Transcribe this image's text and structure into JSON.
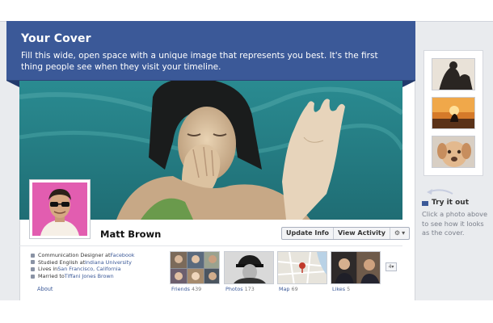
{
  "cover_tip": {
    "title": "Your Cover",
    "text": "Fill this wide, open space with a unique image that represents you best. It's the first thing people see when they visit your timeline."
  },
  "profile": {
    "name": "Matt Brown",
    "update_info_label": "Update Info",
    "view_activity_label": "View Activity",
    "gear_icon": "gear-icon"
  },
  "about": {
    "items": [
      {
        "icon": "work-icon",
        "prefix": "Communication Designer at ",
        "link": "Facebook",
        "suffix": ""
      },
      {
        "icon": "education-icon",
        "prefix": "Studied English at ",
        "link": "Indiana University",
        "suffix": ""
      },
      {
        "icon": "home-icon",
        "prefix": "Lives in ",
        "link": "San Francisco, California",
        "suffix": ""
      },
      {
        "icon": "heart-icon",
        "prefix": "Married to ",
        "link": "Tiffani Jones Brown",
        "suffix": ""
      }
    ],
    "label": "About"
  },
  "tiles": {
    "friends": {
      "label": "Friends",
      "count": "439"
    },
    "photos": {
      "label": "Photos",
      "count": "173"
    },
    "map": {
      "label": "Map",
      "count": "69"
    },
    "likes": {
      "label": "Likes",
      "count": "5"
    },
    "more_label": "4"
  },
  "sidebar": {
    "try_title": "Try it out",
    "try_text": "Click a photo above to see how it looks as the cover."
  },
  "colors": {
    "brand": "#3b5998",
    "link": "#3b5998",
    "muted": "#7a7f8a"
  }
}
